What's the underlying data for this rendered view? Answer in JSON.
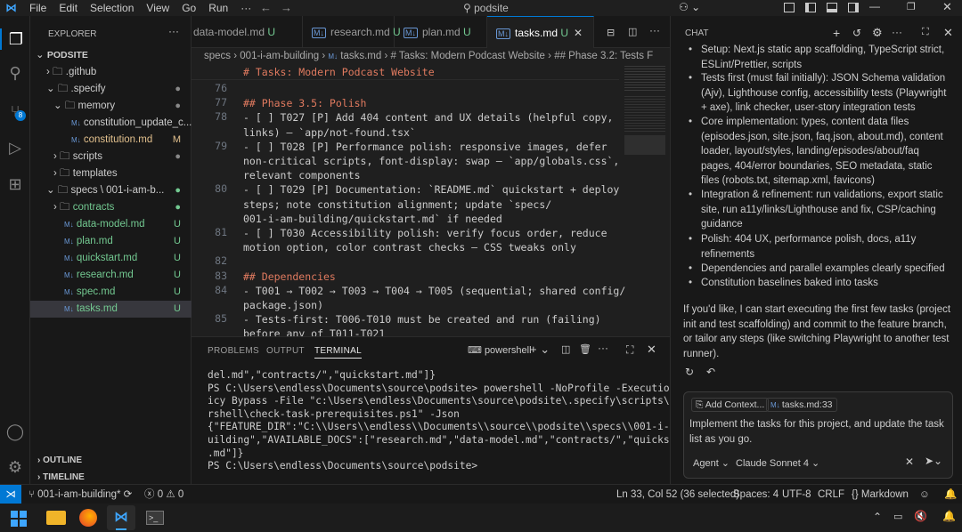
{
  "titlebar": {
    "menu": [
      "File",
      "Edit",
      "Selection",
      "View",
      "Go",
      "Run",
      "···"
    ],
    "search": "podsite"
  },
  "sidebar": {
    "header": "EXPLORER",
    "root": "PODSITE",
    "items": [
      {
        "label": ".github",
        "status": ""
      },
      {
        "label": ".specify",
        "status": "●"
      },
      {
        "label": "memory",
        "status": "●"
      },
      {
        "label": "constitution_update_c...",
        "status": ""
      },
      {
        "label": "constitution.md",
        "status": "M"
      },
      {
        "label": "scripts",
        "status": "●"
      },
      {
        "label": "templates",
        "status": ""
      },
      {
        "label": "specs \\ 001-i-am-b...",
        "status": "●"
      },
      {
        "label": "contracts",
        "status": "●"
      },
      {
        "label": "data-model.md",
        "status": "U"
      },
      {
        "label": "plan.md",
        "status": "U"
      },
      {
        "label": "quickstart.md",
        "status": "U"
      },
      {
        "label": "research.md",
        "status": "U"
      },
      {
        "label": "spec.md",
        "status": "U"
      },
      {
        "label": "tasks.md",
        "status": "U"
      }
    ],
    "outline": "OUTLINE",
    "timeline": "TIMELINE"
  },
  "tabs": [
    {
      "label": "data-model.md",
      "status": "U"
    },
    {
      "label": "research.md",
      "status": "U"
    },
    {
      "label": "plan.md",
      "status": "U"
    },
    {
      "label": "tasks.md",
      "status": "U"
    }
  ],
  "breadcrumb": [
    "specs",
    "001-i-am-building",
    "tasks.md",
    "# Tasks: Modern Podcast Website",
    "## Phase 3.2: Tests F"
  ],
  "editor": {
    "sticky": "# Tasks: Modern Podcast Website",
    "lines": [
      {
        "n": "76",
        "text": ""
      },
      {
        "n": "77",
        "text": "## Phase 3.5: Polish"
      },
      {
        "n": "78",
        "text": "- [ ] T027 [P] Add 404 content and UX details (helpful copy,"
      },
      {
        "n": "",
        "text": "links) — `app/not-found.tsx`"
      },
      {
        "n": "79",
        "text": "- [ ] T028 [P] Performance polish: responsive images, defer"
      },
      {
        "n": "",
        "text": "non-critical scripts, font-display: swap — `app/globals.css`,"
      },
      {
        "n": "",
        "text": "relevant components"
      },
      {
        "n": "80",
        "text": "- [ ] T029 [P] Documentation: `README.md` quickstart + deploy"
      },
      {
        "n": "",
        "text": "steps; note constitution alignment; update `specs/"
      },
      {
        "n": "",
        "text": "001-i-am-building/quickstart.md` if needed"
      },
      {
        "n": "81",
        "text": "- [ ] T030 Accessibility polish: verify focus order, reduce"
      },
      {
        "n": "",
        "text": "motion option, color contrast checks — CSS tweaks only"
      },
      {
        "n": "82",
        "text": ""
      },
      {
        "n": "83",
        "text": "## Dependencies"
      },
      {
        "n": "84",
        "text": "- T001 → T002 → T003 → T004 → T005 (sequential; shared config/"
      },
      {
        "n": "",
        "text": "package.json)"
      },
      {
        "n": "85",
        "text": "- Tests-first: T006-T010 must be created and run (failing)"
      },
      {
        "n": "",
        "text": "before any of T011-T021"
      }
    ]
  },
  "panel": {
    "tabs": [
      "PROBLEMS",
      "OUTPUT",
      "TERMINAL"
    ],
    "shell": "powershell",
    "terminal": [
      "del.md\",\"contracts/\",\"quickstart.md\"]}",
      "PS C:\\Users\\endless\\Documents\\source\\podsite> powershell -NoProfile -ExecutionPol",
      "icy Bypass -File \"c:\\Users\\endless\\Documents\\source\\podsite\\.specify\\scripts\\powe",
      "rshell\\check-task-prerequisites.ps1\" -Json",
      "{\"FEATURE_DIR\":\"C:\\\\Users\\\\endless\\\\Documents\\\\source\\\\podsite\\\\specs\\\\001-i-am-b",
      "uilding\",\"AVAILABLE_DOCS\":[\"research.md\",\"data-model.md\",\"contracts/\",\"quickstart",
      ".md\"]}",
      "PS C:\\Users\\endless\\Documents\\source\\podsite>"
    ]
  },
  "chat": {
    "header": "CHAT",
    "bullets": [
      "Setup: Next.js static app scaffolding, TypeScript strict, ESLint/Prettier, scripts",
      "Tests first (must fail initially): JSON Schema validation (Ajv), Lighthouse config, accessibility tests (Playwright + axe), link checker, user-story integration tests",
      "Core implementation: types, content data files (episodes.json, site.json, faq.json, about.md), content loader, layout/styles, landing/episodes/about/faq pages, 404/error boundaries, SEO metadata, static files (robots.txt, sitemap.xml, favicons)",
      "Integration & refinement: run validations, export static site, run a11y/links/Lighthouse and fix, CSP/caching guidance",
      "Polish: 404 UX, performance polish, docs, a11y refinements",
      "Dependencies and parallel examples clearly specified",
      "Constitution baselines baked into tasks"
    ],
    "closing": "If you'd like, I can start executing the first few tasks (project init and test scaffolding) and commit to the feature branch, or tailor any steps (like switching Playwright to another test runner).",
    "add_context": "Add Context...",
    "context_file": "tasks.md:33",
    "input_text": "Implement the tasks for this project, and update the task list as you go.",
    "mode": "Agent",
    "model": "Claude Sonnet 4"
  },
  "status": {
    "branch": "001-i-am-building*",
    "errors": "0",
    "warnings": "0",
    "position": "Ln 33, Col 52 (36 selected)",
    "spaces": "Spaces: 4",
    "encoding": "UTF-8",
    "eol": "CRLF",
    "language": "Markdown"
  },
  "colors": {
    "accent": "#0078d4",
    "bg": "#1f1f1f",
    "modified": "#e2c08d",
    "untracked": "#73c991",
    "heading": "#e07a5f"
  }
}
